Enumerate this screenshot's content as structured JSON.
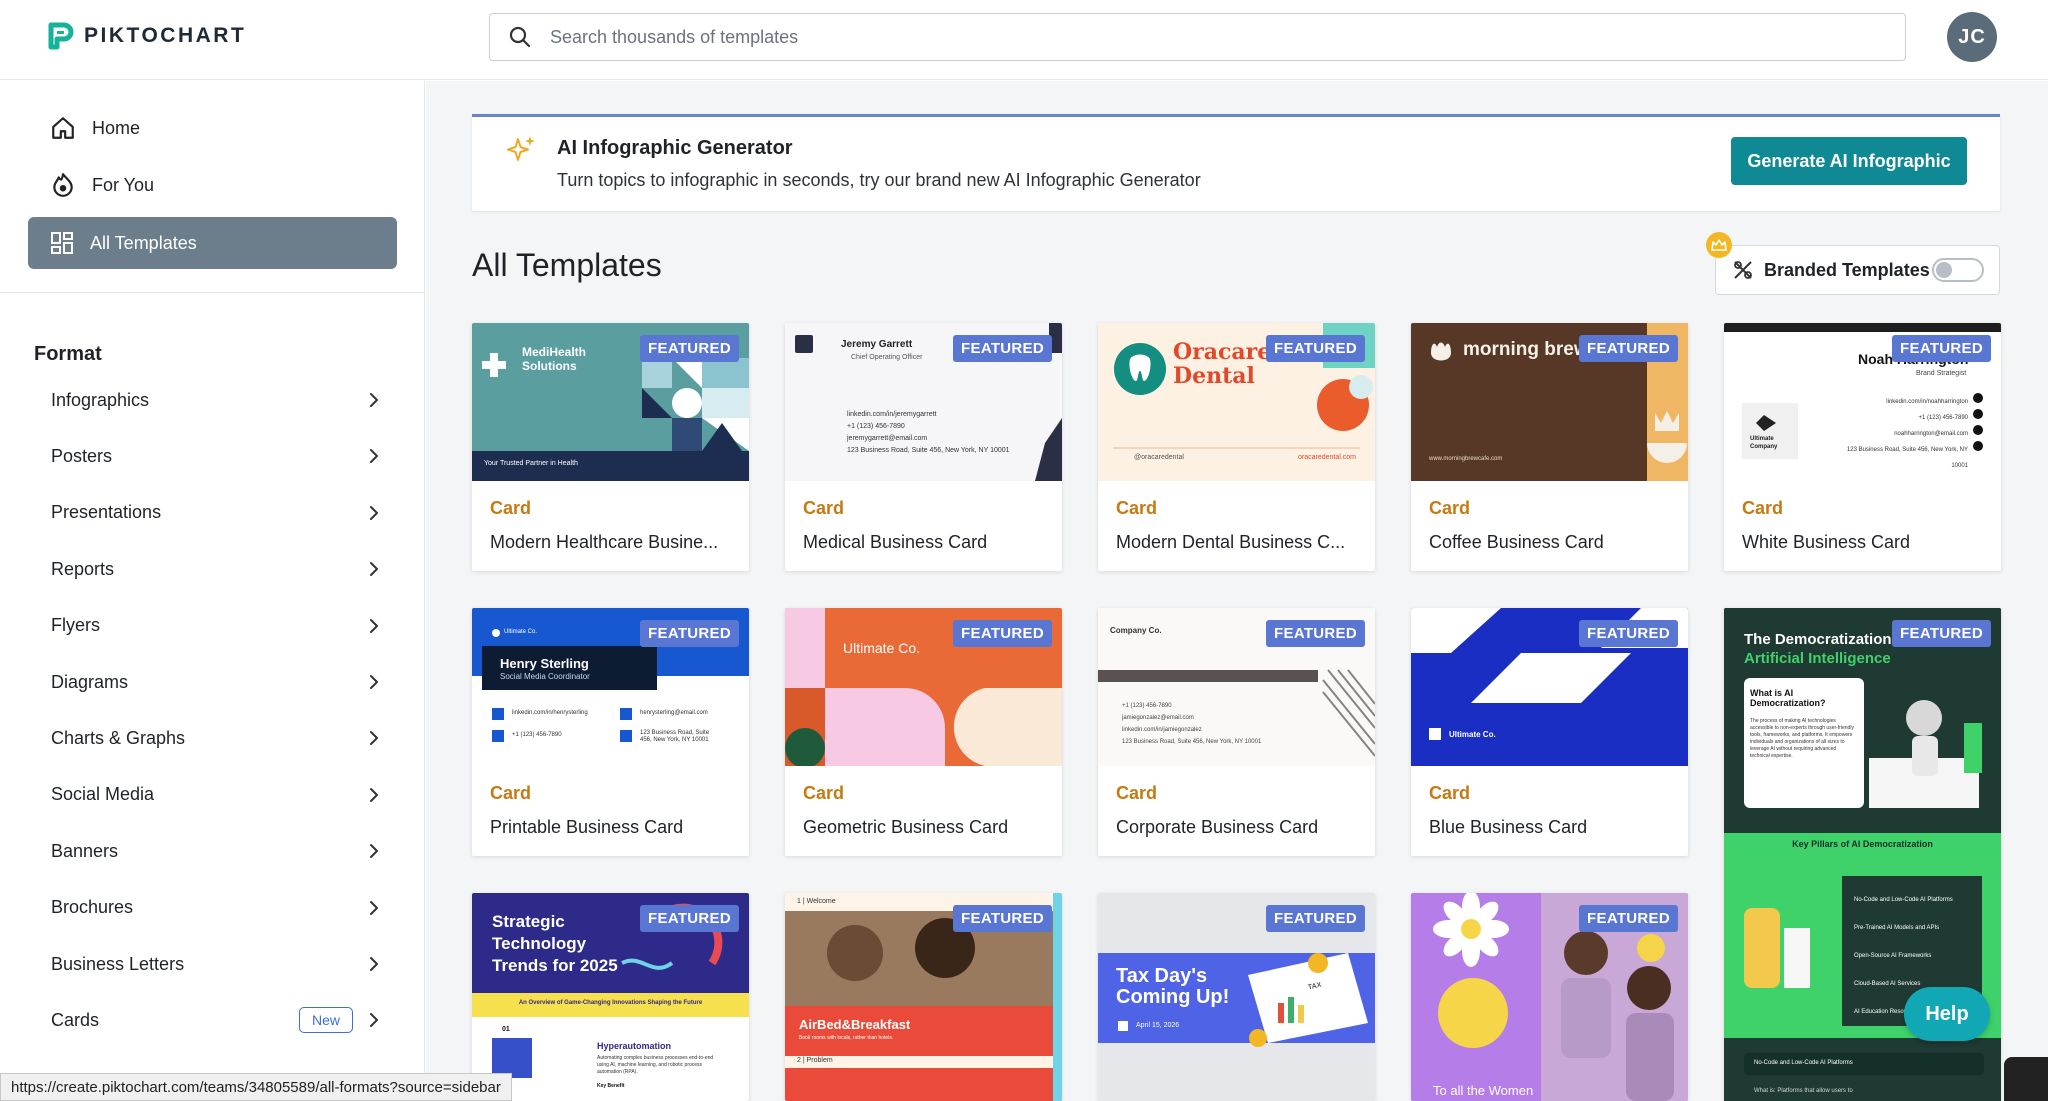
{
  "brand": {
    "name": "PIKTOCHART"
  },
  "search": {
    "placeholder": "Search thousands of templates"
  },
  "user": {
    "initials": "JC"
  },
  "sidebar": {
    "nav": [
      {
        "label": "Home",
        "icon": "home-icon"
      },
      {
        "label": "For You",
        "icon": "for-you-icon"
      },
      {
        "label": "All Templates",
        "icon": "grid-icon",
        "active": true
      }
    ],
    "format_title": "Format",
    "formats": [
      {
        "label": "Infographics"
      },
      {
        "label": "Posters"
      },
      {
        "label": "Presentations"
      },
      {
        "label": "Reports"
      },
      {
        "label": "Flyers"
      },
      {
        "label": "Diagrams"
      },
      {
        "label": "Charts & Graphs"
      },
      {
        "label": "Social Media"
      },
      {
        "label": "Banners"
      },
      {
        "label": "Brochures"
      },
      {
        "label": "Business Letters"
      },
      {
        "label": "Cards",
        "badge": "New"
      }
    ]
  },
  "ai_banner": {
    "title": "AI Infographic Generator",
    "subtitle": "Turn topics to infographic in seconds, try our brand new AI Infographic Generator",
    "button": "Generate AI Infographic"
  },
  "main": {
    "title": "All Templates",
    "branded_label": "Branded Templates",
    "branded_enabled": false
  },
  "featured_label": "FEATURED",
  "cards": [
    {
      "category": "Card",
      "name": "Modern Healthcare Busine...",
      "thumb": {
        "org": "MediHealth Solutions",
        "tagline": "Your Trusted Partner in Health"
      }
    },
    {
      "category": "Card",
      "name": "Medical Business Card",
      "thumb": {
        "person": "Jeremy Garrett",
        "role": "Chief Operating Officer",
        "l1": "linkedin.com/in/jeremygarrett",
        "l2": "+1 (123) 456-7890",
        "l3": "jeremygarrett@email.com",
        "l4": "123 Business Road, Suite 456, New York, NY 10001"
      }
    },
    {
      "category": "Card",
      "name": "Modern Dental Business C...",
      "thumb": {
        "org": "Oracare Dental",
        "handle": "@oracaredental",
        "site": "oracaredental.com"
      }
    },
    {
      "category": "Card",
      "name": "Coffee Business Card",
      "thumb": {
        "org": "morning brew café",
        "site": "www.morningbrewcafe.com"
      }
    },
    {
      "category": "Card",
      "name": "White Business Card",
      "thumb": {
        "person": "Noah Harrington",
        "role": "Brand Strategist",
        "org": "Ultimate Company",
        "l1": "linkedin.com/in/noahharrington",
        "l2": "+1 (123) 456-7890",
        "l3": "noahharrington@email.com",
        "l4": "123 Business Road, Suite 456, New York, NY 10001"
      }
    },
    {
      "category": "Card",
      "name": "Printable Business Card",
      "thumb": {
        "org": "Ultimate Co.",
        "person": "Henry Sterling",
        "role": "Social Media Coordinator",
        "l1": "linkedin.com/in/henrysterling",
        "l2": "henrysterling@email.com",
        "l3": "+1 (123) 456-7890",
        "l4": "123 Business Road, Suite 456, New York, NY 10001"
      }
    },
    {
      "category": "Card",
      "name": "Geometric Business Card",
      "thumb": {
        "org": "Ultimate Co."
      }
    },
    {
      "category": "Card",
      "name": "Corporate Business Card",
      "thumb": {
        "org": "Company Co.",
        "l1": "+1 (123) 456-7890",
        "l2": "jamiegonzalez@email.com",
        "l3": "linkedin.com/in/jamiegonzalez",
        "l4": "123 Business Road, Suite 456, New York, NY 10001"
      }
    },
    {
      "category": "Card",
      "name": "Blue Business Card",
      "thumb": {
        "org": "Ultimate Co."
      }
    },
    {
      "category": "",
      "name": "",
      "thumb": {
        "title1": "The Democratization of",
        "title2": "Artificial Intelligence",
        "q": "What is AI Democratization?",
        "body": "The process of making AI technologies accessible to non-experts through user-friendly tools, frameworks, and platforms. It empowers individuals and organizations of all sizes to leverage AI without requiring advanced technical expertise.",
        "pillars": "Key Pillars of AI Democratization",
        "p1": "No-Code and Low-Code AI Platforms",
        "p2": "Pre-Trained AI Models and APIs",
        "p3": "Open-Source AI Frameworks",
        "p4": "Cloud-Based AI Services",
        "p5": "AI Education Resources",
        "s1": "No-Code and Low-Code AI Platforms",
        "s2": "What is: Platforms that allow users to"
      }
    },
    {
      "category": "",
      "name": "",
      "thumb": {
        "title": "Strategic Technology Trends for 2025",
        "strip": "An Overview of Game-Changing Innovations Shaping the Future",
        "num": "01",
        "h": "Hyperautomation",
        "body": "Automating complex business processes end-to-end using AI, machine learning, and robotic process automation (RPA).",
        "more": "Key Benefit"
      }
    },
    {
      "category": "",
      "name": "",
      "thumb": {
        "top": "1 | Welcome",
        "brand": "AirBed&Breakfast",
        "tag": "Book rooms with locals, rather than hotels.",
        "next": "2 | Problem"
      }
    },
    {
      "category": "",
      "name": "",
      "thumb": {
        "title": "Tax Day's Coming Up!",
        "date": "April 15, 2026",
        "stamp": "TAX"
      }
    },
    {
      "category": "",
      "name": "",
      "thumb": {
        "text": "To all the Women"
      }
    }
  ],
  "help_label": "Help",
  "status_url": "https://create.piktochart.com/teams/34805589/all-formats?source=sidebar"
}
